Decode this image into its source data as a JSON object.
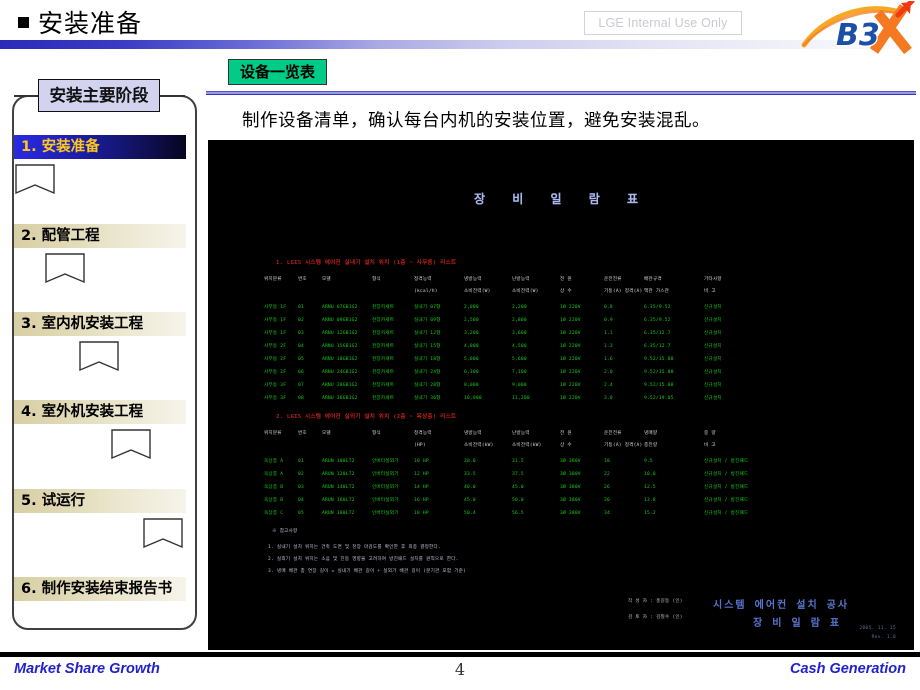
{
  "header": {
    "title": "安装准备",
    "bullet_icon": "square-bullet-icon",
    "confidential_label": "LGE Internal Use Only",
    "logo_text_primary": "B3",
    "logo_text_accent": "X",
    "logo_name": "b3x-logo",
    "accent_blue": "#2b2bb8",
    "accent_orange": "#f47920"
  },
  "sidebar": {
    "title": "安装主要阶段",
    "active_index": 0,
    "active_text_color": "#ffc81e",
    "active_bg_color": "#1c1c9e",
    "inactive_bg_color": "#ddd5ad",
    "items": [
      {
        "label": "1. 安装准备",
        "active": true
      },
      {
        "label": "2. 配管工程",
        "active": false
      },
      {
        "label": "3. 室内机安装工程",
        "active": false
      },
      {
        "label": "4. 室外机安装工程",
        "active": false
      },
      {
        "label": "5. 试运行",
        "active": false
      },
      {
        "label": "6. 制作安装结束报告书",
        "active": false
      }
    ]
  },
  "content": {
    "badge_label": "设备一览表",
    "badge_color": "#00cc88",
    "caption": "制作设备清单，确认每台内机的安装位置，避免安装混乱。"
  },
  "screenshot": {
    "name": "equipment-list-document-screenshot",
    "background_color": "#000000",
    "doc_title": "장 비 일 람 표",
    "table1": {
      "heading": "1. LGIS 시스템 에어컨 실내기 설치 위치 (1층 ~ 사무동) 리스트",
      "colheads_row1": [
        "위치분류",
        "번호",
        "모델",
        "형식",
        "정격능력",
        "냉방능력",
        "난방능력",
        "전  원",
        "운전전류",
        "배관규격",
        "기타사항"
      ],
      "colheads_row2": [
        "",
        "",
        "",
        "",
        "(kcal/h)",
        "소비전력(W)",
        "소비전력(W)",
        "상 수",
        "기동(A) 정격(A)",
        "액관  가스관",
        "비  고"
      ],
      "rows": [
        [
          "사무동 1F",
          "01",
          "ARNU 07GB1G2",
          "천장카세트",
          "실내기 07형",
          "2,000",
          "2,200",
          "1Ø 220V",
          "0.8",
          "6.35/9.52",
          "신규설치"
        ],
        [
          "사무동 1F",
          "02",
          "ARNU 09GB1G2",
          "천장카세트",
          "실내기 09형",
          "2,500",
          "2,800",
          "1Ø 220V",
          "0.9",
          "6.35/9.52",
          "신규설치"
        ],
        [
          "사무동 1F",
          "03",
          "ARNU 12GB1G2",
          "천장카세트",
          "실내기 12형",
          "3,200",
          "3,600",
          "1Ø 220V",
          "1.1",
          "6.35/12.7",
          "신규설치"
        ],
        [
          "사무동 2F",
          "04",
          "ARNU 15GB1G2",
          "천장카세트",
          "실내기 15형",
          "4,000",
          "4,500",
          "1Ø 220V",
          "1.3",
          "6.35/12.7",
          "신규설치"
        ],
        [
          "사무동 2F",
          "05",
          "ARNU 18GB1G2",
          "천장카세트",
          "실내기 18형",
          "5,000",
          "5,600",
          "1Ø 220V",
          "1.6",
          "9.52/15.88",
          "신규설치"
        ],
        [
          "사무동 2F",
          "06",
          "ARNU 24GB1G2",
          "천장카세트",
          "실내기 24형",
          "6,300",
          "7,100",
          "1Ø 220V",
          "2.0",
          "9.52/15.88",
          "신규설치"
        ],
        [
          "사무동 3F",
          "07",
          "ARNU 28GB1G2",
          "천장카세트",
          "실내기 28형",
          "8,000",
          "9,000",
          "1Ø 220V",
          "2.4",
          "9.52/15.88",
          "신규설치"
        ],
        [
          "사무동 3F",
          "08",
          "ARNU 36GB1G2",
          "천장카세트",
          "실내기 36형",
          "10,000",
          "11,200",
          "1Ø 220V",
          "3.0",
          "9.52/19.05",
          "신규설치"
        ]
      ]
    },
    "table2": {
      "heading": "2. LGIS 시스템 에어컨 실외기 설치 위치 (2층 ~ 옥상층) 리스트",
      "colheads_row1": [
        "위치분류",
        "번호",
        "모델",
        "형식",
        "정격능력",
        "냉방능력",
        "난방능력",
        "전  원",
        "운전전류",
        "냉매량",
        "중  량"
      ],
      "colheads_row2": [
        "",
        "",
        "",
        "",
        "(HP)",
        "소비전력(kW)",
        "소비전력(kW)",
        "상 수",
        "기동(A) 정격(A)",
        "충전량",
        "비  고"
      ],
      "rows": [
        [
          "옥상층 A",
          "01",
          "ARUN 100LT2",
          "인버터실외기",
          "10 HP",
          "28.0",
          "31.5",
          "3Ø 380V",
          "18",
          "9.5",
          "신규설치 / 방진패드"
        ],
        [
          "옥상층 A",
          "02",
          "ARUN 120LT2",
          "인버터실외기",
          "12 HP",
          "33.5",
          "37.5",
          "3Ø 380V",
          "22",
          "10.8",
          "신규설치 / 방진패드"
        ],
        [
          "옥상층 B",
          "03",
          "ARUN 140LT2",
          "인버터실외기",
          "14 HP",
          "40.0",
          "45.0",
          "3Ø 380V",
          "26",
          "12.5",
          "신규설치 / 방진패드"
        ],
        [
          "옥상층 B",
          "04",
          "ARUN 160LT2",
          "인버터실외기",
          "16 HP",
          "45.0",
          "50.0",
          "3Ø 380V",
          "30",
          "13.8",
          "신규설치 / 방진패드"
        ],
        [
          "옥상층 C",
          "05",
          "ARUN 180LT2",
          "인버터실외기",
          "18 HP",
          "50.4",
          "56.5",
          "3Ø 380V",
          "34",
          "15.2",
          "신규설치 / 방진패드"
        ]
      ]
    },
    "notes_title": "※ 참고사항",
    "notes": [
      "1. 실내기 설치 위치는 건축 도면 및 천장 마감도를 확인한 후 최종 결정한다.",
      "2. 실외기 설치 위치는 소음 및 진동 영향을 고려하여 방진패드 설치를 원칙으로 한다.",
      "3. 냉매 배관 총 연장 길이 = 실내기 배관 길이 + 실외기 배관 길이 (분기관 포함 기준)"
    ],
    "signature_lines": [
      "작 성 자 :  홍길동  (인)",
      "검 토 자 :  김철수  (인)"
    ],
    "stamp_lines": [
      "시스템 에어컨 설치 공사",
      "장 비 일 람 표"
    ],
    "corner_marks": [
      "2005. 11. 15",
      "Rev. 1.0"
    ]
  },
  "footer": {
    "left_label": "Market Share Growth",
    "right_label": "Cash Generation",
    "page_number": "4",
    "text_color": "#2222cc"
  }
}
